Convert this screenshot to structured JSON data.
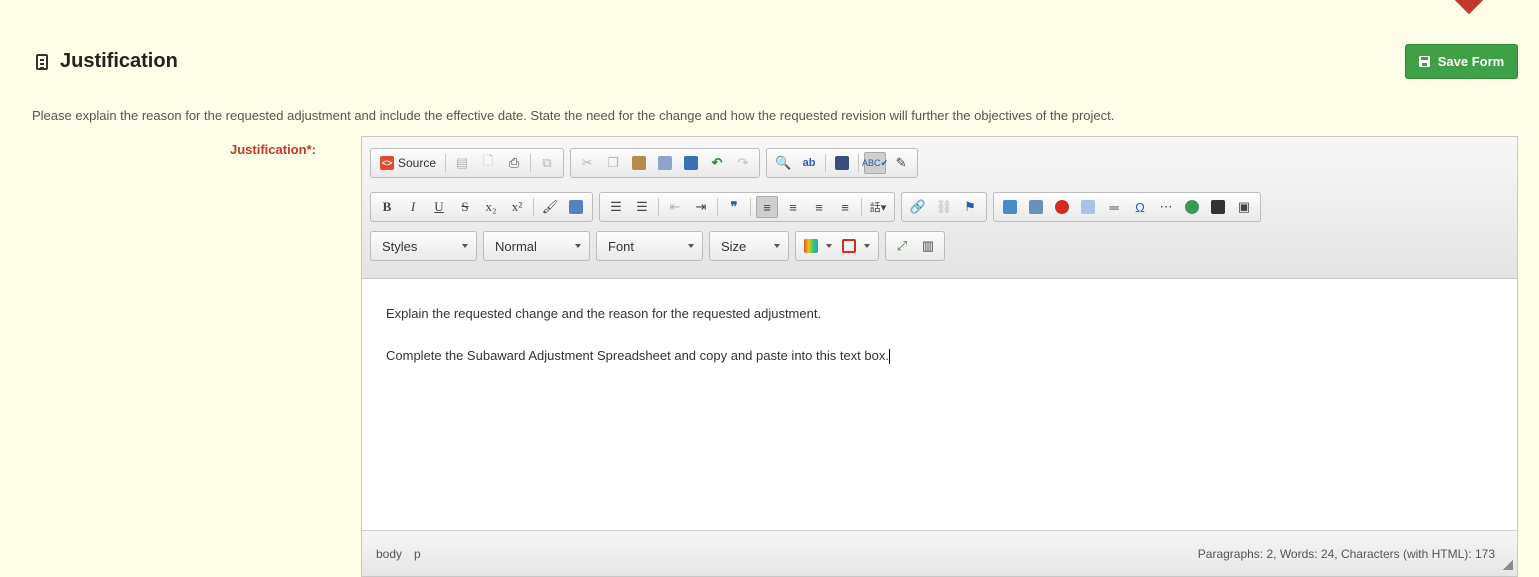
{
  "section": {
    "title": "Justification"
  },
  "save_button": {
    "label": "Save Form"
  },
  "instructions": "Please explain the reason for the requested adjustment and include the effective date. State the need for the change and how the requested revision will further the objectives of the project.",
  "field": {
    "label": "Justification*:"
  },
  "toolbar": {
    "source_label": "Source",
    "styles": "Styles",
    "format": "Normal",
    "font": "Font",
    "size": "Size"
  },
  "editor": {
    "paragraphs": [
      "Explain the requested change and the reason for the requested adjustment.",
      "Complete the Subaward Adjustment Spreadsheet and copy and paste into this text box."
    ]
  },
  "status": {
    "path": [
      "body",
      "p"
    ],
    "stats": "Paragraphs: 2, Words: 24, Characters (with HTML): 173"
  },
  "colors": {
    "page_bg": "#fdfde8",
    "save_button": "#3fa046",
    "required_label": "#c0392b"
  }
}
